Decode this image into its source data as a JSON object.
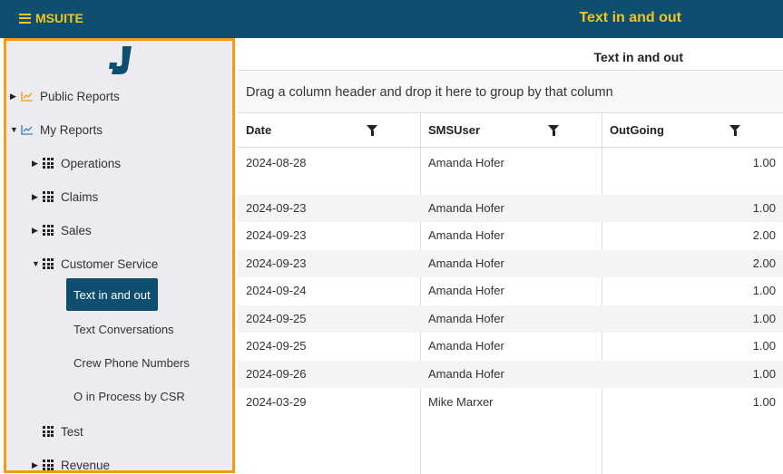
{
  "app": {
    "brand": "MSUITE",
    "title": "Text in and out"
  },
  "sidebar": {
    "items": [
      {
        "label": "Public Reports"
      },
      {
        "label": "My Reports"
      },
      {
        "label": "Operations"
      },
      {
        "label": "Claims"
      },
      {
        "label": "Sales"
      },
      {
        "label": "Customer Service"
      },
      {
        "label": "Text in and out"
      },
      {
        "label": "Text Conversations"
      },
      {
        "label": "Crew Phone Numbers"
      },
      {
        "label": "O in Process by CSR"
      },
      {
        "label": "Test"
      },
      {
        "label": "Revenue"
      }
    ]
  },
  "report": {
    "title": "Text in and out",
    "group_hint": "Drag a column header and drop it here to group by that column",
    "columns": [
      "Date",
      "SMSUser",
      "OutGoing"
    ],
    "rows": [
      [
        "2024-08-28",
        "Amanda Hofer",
        "1.00"
      ],
      [
        "2024-09-23",
        "Amanda Hofer",
        "1.00"
      ],
      [
        "2024-09-23",
        "Amanda Hofer",
        "2.00"
      ],
      [
        "2024-09-23",
        "Amanda Hofer",
        "2.00"
      ],
      [
        "2024-09-24",
        "Amanda Hofer",
        "1.00"
      ],
      [
        "2024-09-25",
        "Amanda Hofer",
        "1.00"
      ],
      [
        "2024-09-25",
        "Amanda Hofer",
        "1.00"
      ],
      [
        "2024-09-26",
        "Amanda Hofer",
        "1.00"
      ],
      [
        "2024-03-29",
        "Mike Marxer",
        "1.00"
      ]
    ]
  },
  "colors": {
    "header_bg": "#0e4e6e",
    "accent": "#f5c518",
    "sidebar_border": "#f39c12"
  }
}
